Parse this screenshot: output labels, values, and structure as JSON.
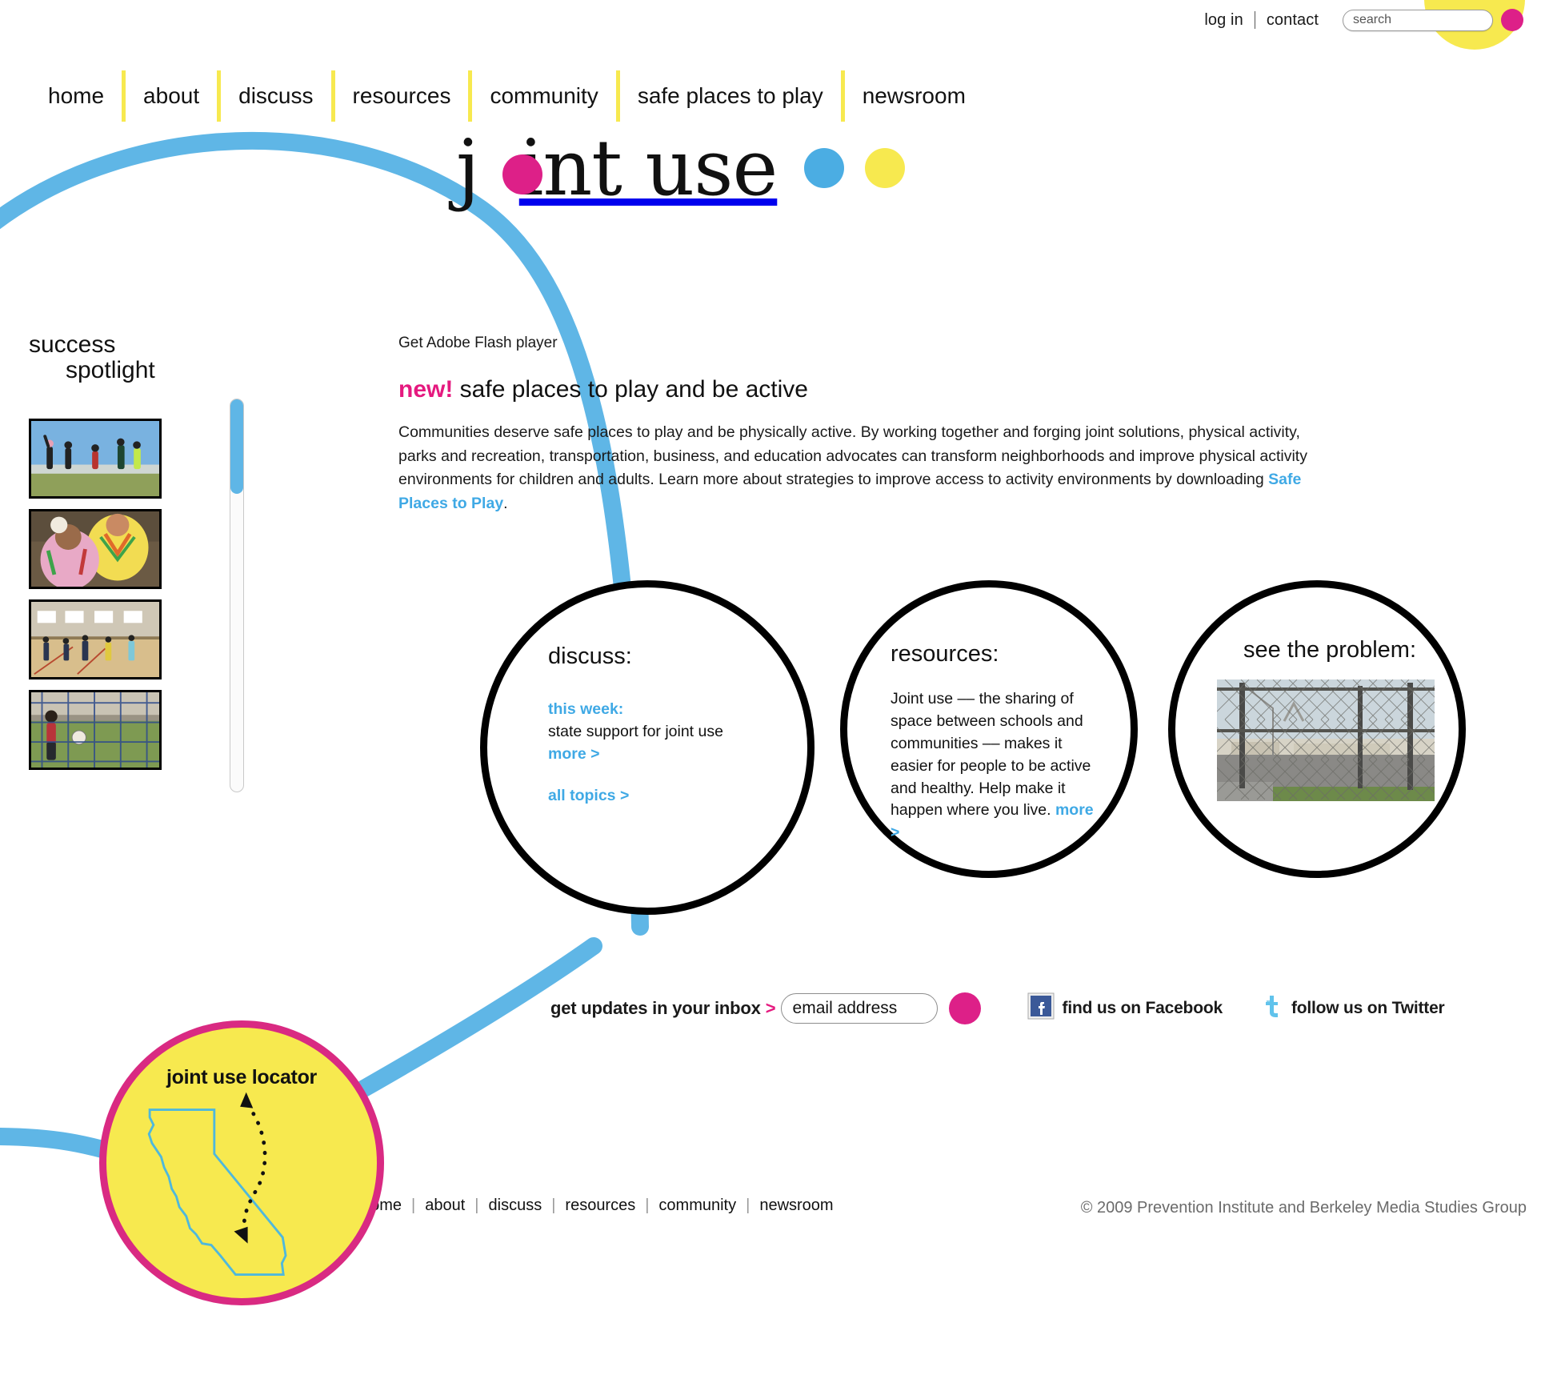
{
  "utility": {
    "login": "log in",
    "contact": "contact",
    "search_placeholder": "search",
    "search_value": ""
  },
  "nav": {
    "items": [
      {
        "label": "home"
      },
      {
        "label": "about"
      },
      {
        "label": "discuss"
      },
      {
        "label": "resources"
      },
      {
        "label": "community"
      },
      {
        "label": "safe places to play"
      },
      {
        "label": "newsroom"
      }
    ]
  },
  "logo": {
    "text_before": "j",
    "text_after": "int use",
    "dot_colors": [
      "#4BADE3",
      "#F7E94F"
    ],
    "accent_color": "#DD2088"
  },
  "spotlight": {
    "title_line1": "success",
    "title_line2": "spotlight",
    "thumbnails": [
      {
        "alt": "youth soccer players celebrating on a grass field"
      },
      {
        "alt": "two girls in colorful folkloric dance costumes"
      },
      {
        "alt": "students in a school gymnasium activity class"
      },
      {
        "alt": "girl in red soccer uniform behind a goal net"
      }
    ]
  },
  "content": {
    "flash_note": "Get Adobe Flash player",
    "heading_flag": "new!",
    "heading_rest": " safe places to play and be active",
    "body_text": "Communities deserve safe places to play and be physically active. By working together and forging joint solutions, physical activity, parks and recreation, transportation, business, and education advocates can transform neighborhoods and improve physical activity environments for children and adults. Learn more about strategies to improve access to activity environments by downloading ",
    "body_link": "Safe Places to Play",
    "body_tail": "."
  },
  "bubbles": {
    "discuss": {
      "title": "discuss:",
      "this_week_label": "this week:",
      "topic": "state support for joint use",
      "more_link": "more >",
      "all_topics_link": "all topics >"
    },
    "resources": {
      "title": "resources:",
      "text": "Joint use –– the sharing of space between schools and communities –– makes it easier for people to be active and healthy. Help make it happen where you live. ",
      "more_link": "more >"
    },
    "problem": {
      "title": "see the problem:",
      "photo_alt": "locked chain-link fence blocking an empty school basketball court"
    }
  },
  "newsletter": {
    "label": "get updates in your inbox",
    "caret": ">",
    "email_placeholder": "email address",
    "email_value": ""
  },
  "social": {
    "facebook": "find us on Facebook",
    "twitter": "follow us on Twitter"
  },
  "locator": {
    "label": "joint use locator"
  },
  "footer": {
    "items": [
      {
        "label": "home"
      },
      {
        "label": "about"
      },
      {
        "label": "discuss"
      },
      {
        "label": "resources"
      },
      {
        "label": "community"
      },
      {
        "label": "newsroom"
      }
    ],
    "separator": "|",
    "copyright": "© 2009 Prevention Institute and Berkeley Media Studies Group"
  },
  "colors": {
    "magenta": "#DD2088",
    "blue": "#4BADE3",
    "yellow": "#F7E94F",
    "link_blue": "#3FA9E5",
    "pink_accent": "#E5197F"
  }
}
